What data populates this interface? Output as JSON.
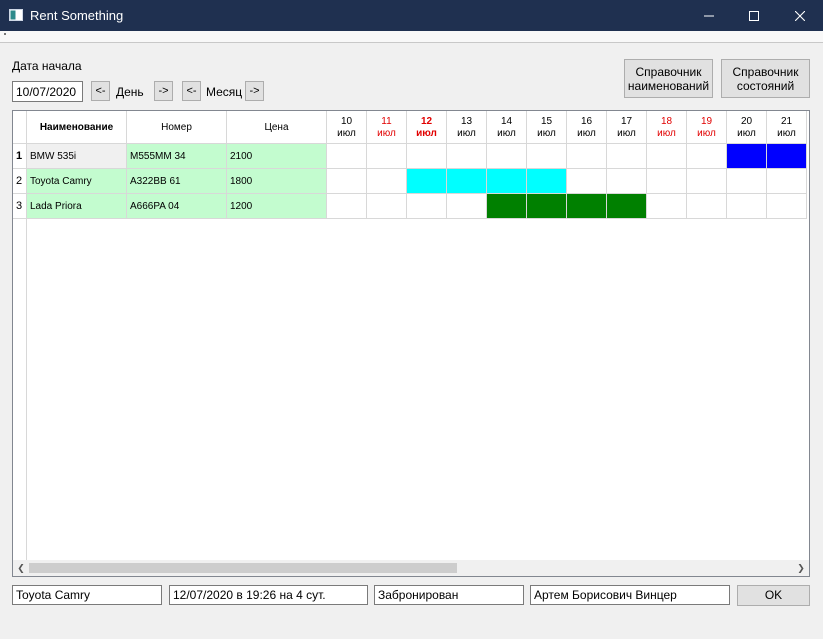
{
  "window": {
    "title": "Rent Something"
  },
  "controls": {
    "start_date_label": "Дата начала",
    "start_date_value": "10/07/2020",
    "day_prev": "<-",
    "day_label": "День",
    "day_next": "->",
    "month_prev": "<-",
    "month_label": "Месяц",
    "month_next": "->",
    "ref_names_line1": "Справочник",
    "ref_names_line2": "наименований",
    "ref_states_line1": "Справочник",
    "ref_states_line2": "состояний"
  },
  "table": {
    "columns": [
      "Наименование",
      "Номер",
      "Цена"
    ],
    "dates": [
      {
        "day": "10",
        "month": "июл",
        "weekend": false,
        "today": false
      },
      {
        "day": "11",
        "month": "июл",
        "weekend": true,
        "today": false
      },
      {
        "day": "12",
        "month": "июл",
        "weekend": true,
        "today": true
      },
      {
        "day": "13",
        "month": "июл",
        "weekend": false,
        "today": false
      },
      {
        "day": "14",
        "month": "июл",
        "weekend": false,
        "today": false
      },
      {
        "day": "15",
        "month": "июл",
        "weekend": false,
        "today": false
      },
      {
        "day": "16",
        "month": "июл",
        "weekend": false,
        "today": false
      },
      {
        "day": "17",
        "month": "июл",
        "weekend": false,
        "today": false
      },
      {
        "day": "18",
        "month": "июл",
        "weekend": true,
        "today": false
      },
      {
        "day": "19",
        "month": "июл",
        "weekend": true,
        "today": false
      },
      {
        "day": "20",
        "month": "июл",
        "weekend": false,
        "today": false
      },
      {
        "day": "21",
        "month": "июл",
        "weekend": false,
        "today": false
      }
    ],
    "rows": [
      {
        "num": "1",
        "name": "BMW 535i",
        "plate": "M555MM 34",
        "price": "2100",
        "selected": true,
        "bookings": [
          {
            "start": 10,
            "end": 12,
            "color": "#0000ff"
          }
        ]
      },
      {
        "num": "2",
        "name": "Toyota Camry",
        "plate": "A322BB 61",
        "price": "1800",
        "selected": false,
        "bookings": [
          {
            "start": 2,
            "end": 5,
            "color": "#00ffff"
          }
        ]
      },
      {
        "num": "3",
        "name": "Lada Priora",
        "plate": "A666PA 04",
        "price": "1200",
        "selected": false,
        "bookings": [
          {
            "start": 4,
            "end": 7,
            "color": "#008000"
          }
        ]
      }
    ]
  },
  "status": {
    "car": "Toyota Camry",
    "period": "12/07/2020 в 19:26 на 4 сут.",
    "state": "Забронирован",
    "client": "Артем Борисович Винцер",
    "ok": "OK"
  },
  "colors": {
    "titlebar": "#1f3050",
    "info_cell": "#c3fccf",
    "weekend_text": "#e10000"
  }
}
